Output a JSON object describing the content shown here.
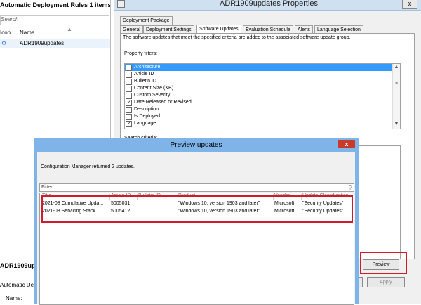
{
  "console": {
    "header": "Automatic Deployment Rules 1 items",
    "search_placeholder": "Search",
    "columns": [
      "Icon",
      "Name"
    ],
    "rows": [
      {
        "name": "ADR1909updates"
      }
    ],
    "lower_title": "ADR1909up",
    "lower_label": "Automatic De",
    "lower_name_label": "Name:"
  },
  "props": {
    "title": "ADR1909updates Properties",
    "close_label": "x",
    "top_tab": "Deployment Package",
    "tabs": [
      "General",
      "Deployment Settings",
      "Software Updates",
      "Evaluation Schedule",
      "Alerts",
      "Language Selection"
    ],
    "active_tab": "Software Updates",
    "description": "The software updates that meet the specified criteria are added to the associated software update group.",
    "property_filters_label": "Property filters:",
    "property_filters": [
      {
        "label": "Architecture",
        "checked": false,
        "selected": true
      },
      {
        "label": "Article ID",
        "checked": false
      },
      {
        "label": "Bulletin ID",
        "checked": false
      },
      {
        "label": "Content Size (KB)",
        "checked": false
      },
      {
        "label": "Custom Severity",
        "checked": false
      },
      {
        "label": "Date Released or Revised",
        "checked": true
      },
      {
        "label": "Description",
        "checked": false
      },
      {
        "label": "Is Deployed",
        "checked": false
      },
      {
        "label": "Language",
        "checked": true
      }
    ],
    "search_criteria_label": "Search criteria:",
    "preview_button": "Preview",
    "apply_button": "Apply"
  },
  "preview": {
    "title": "Preview updates",
    "close_label": "x",
    "message": "Configuration Manager returned 2 updates.",
    "filter_placeholder": "Filter...",
    "columns": [
      "Title",
      "Article ID",
      "Bulletin ID",
      "Product",
      "Vendor",
      "Update Classification"
    ],
    "rows": [
      {
        "title": "2021-08 Cumulative Upda...",
        "article_id": "5005031",
        "bulletin_id": "",
        "product": "\"Windows 10, version 1903 and later\"",
        "vendor": "Microsoft",
        "classification": "\"Security Updates\""
      },
      {
        "title": "2021-08 Servicing Stack ...",
        "article_id": "5005412",
        "bulletin_id": "",
        "product": "\"Windows 10, version 1903 and later\"",
        "vendor": "Microsoft",
        "classification": "\"Security Updates\""
      }
    ]
  },
  "colors": {
    "highlight_red": "#d11a2a",
    "selection_blue": "#3399ff",
    "preview_frame": "#7eb4e8"
  }
}
